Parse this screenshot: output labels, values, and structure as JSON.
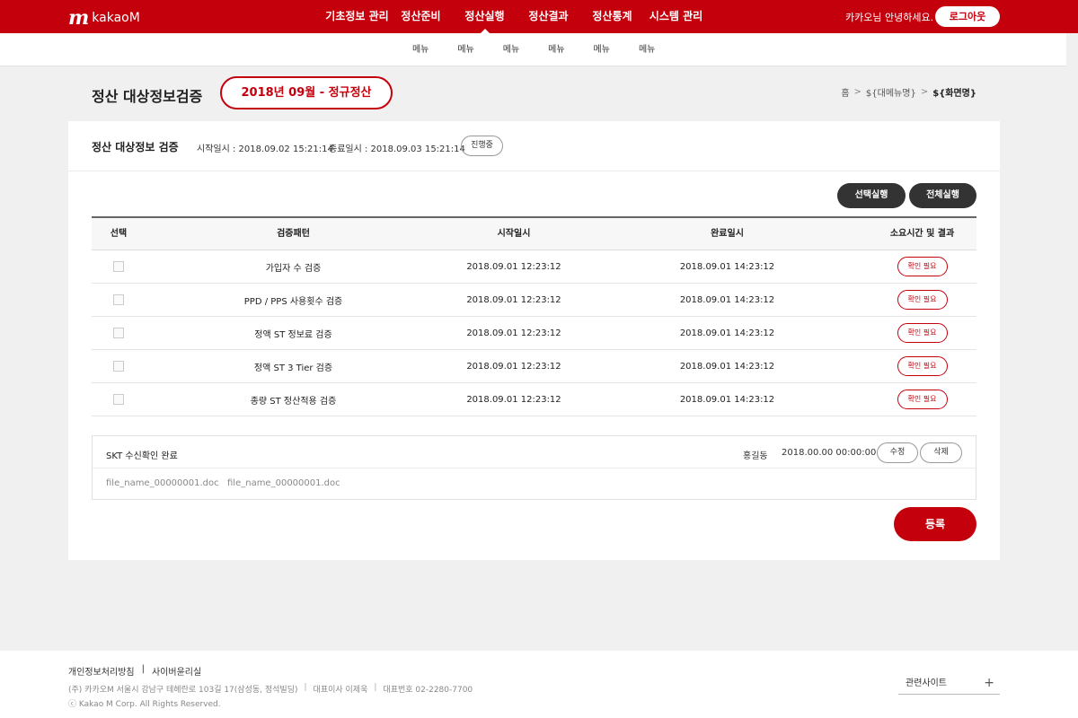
{
  "header": {
    "logo_mark": "m",
    "logo_text": "kakaoM",
    "nav": [
      "기초정보 관리",
      "정산준비",
      "정산실행",
      "정산결과",
      "정산통계",
      "시스템 관리"
    ],
    "greeting": "카카오님 안녕하세요.",
    "logout_label": "로그아웃"
  },
  "subnav": [
    "메뉴",
    "메뉴",
    "메뉴",
    "메뉴",
    "메뉴",
    "메뉴"
  ],
  "page": {
    "title": "정산 대상정보검증",
    "period_badge": "2018년 09월 - 정규정산",
    "breadcrumb": {
      "home": "홈",
      "sep": ">",
      "menu": "${대메뉴명}",
      "current": "${화면명}"
    }
  },
  "card": {
    "title": "정산 대상정보 검증",
    "start_time": "시작일시 : 2018.09.02 15:21:14",
    "end_time": "종료일시 : 2018.09.03 15:21:14",
    "progress_badge": "진행중",
    "select_run_label": "선택실행",
    "all_run_label": "전체실행"
  },
  "table": {
    "headers": [
      "선택",
      "검증패턴",
      "시작일시",
      "완료일시",
      "소요시간 및 결과"
    ],
    "rows": [
      {
        "pattern": "가입자 수 검증",
        "start": "2018.09.01  12:23:12",
        "end": "2018.09.01  14:23:12",
        "result": "확인 필요"
      },
      {
        "pattern": "PPD / PPS 사용횟수 검증",
        "start": "2018.09.01  12:23:12",
        "end": "2018.09.01  14:23:12",
        "result": "확인 필요"
      },
      {
        "pattern": "정액 ST 정보료 검증",
        "start": "2018.09.01  12:23:12",
        "end": "2018.09.01  14:23:12",
        "result": "확인 필요"
      },
      {
        "pattern": "정액 ST 3 Tier 검증",
        "start": "2018.09.01  12:23:12",
        "end": "2018.09.01  14:23:12",
        "result": "확인 필요"
      },
      {
        "pattern": "종량 ST 정산적용 검증",
        "start": "2018.09.01  12:23:12",
        "end": "2018.09.01  14:23:12",
        "result": "확인 필요"
      }
    ]
  },
  "skt": {
    "status": "SKT 수신확인 완료",
    "user": "홍길동",
    "time": "2018.00.00 00:00:00",
    "edit_label": "수정",
    "delete_label": "삭제",
    "files": [
      "file_name_00000001.doc",
      "file_name_00000001.doc"
    ]
  },
  "register_label": "등록",
  "footer": {
    "links": [
      "개인정보처리방침",
      "사이버윤리실"
    ],
    "link_divider": "|",
    "address": [
      "(주) 카카오M 서울시 강남구 테헤란로 103길 17(삼성동, 정석빌딩)",
      "대표이사 이제욱",
      "대표번호 02-2280-7700"
    ],
    "address_divider": "|",
    "copyright": "ⓒ Kakao M Corp. All Rights Reserved.",
    "related_site": "관련사이트",
    "related_plus": "+"
  },
  "colors": {
    "brand_red": "#c4000d",
    "dark_button": "#333333"
  }
}
